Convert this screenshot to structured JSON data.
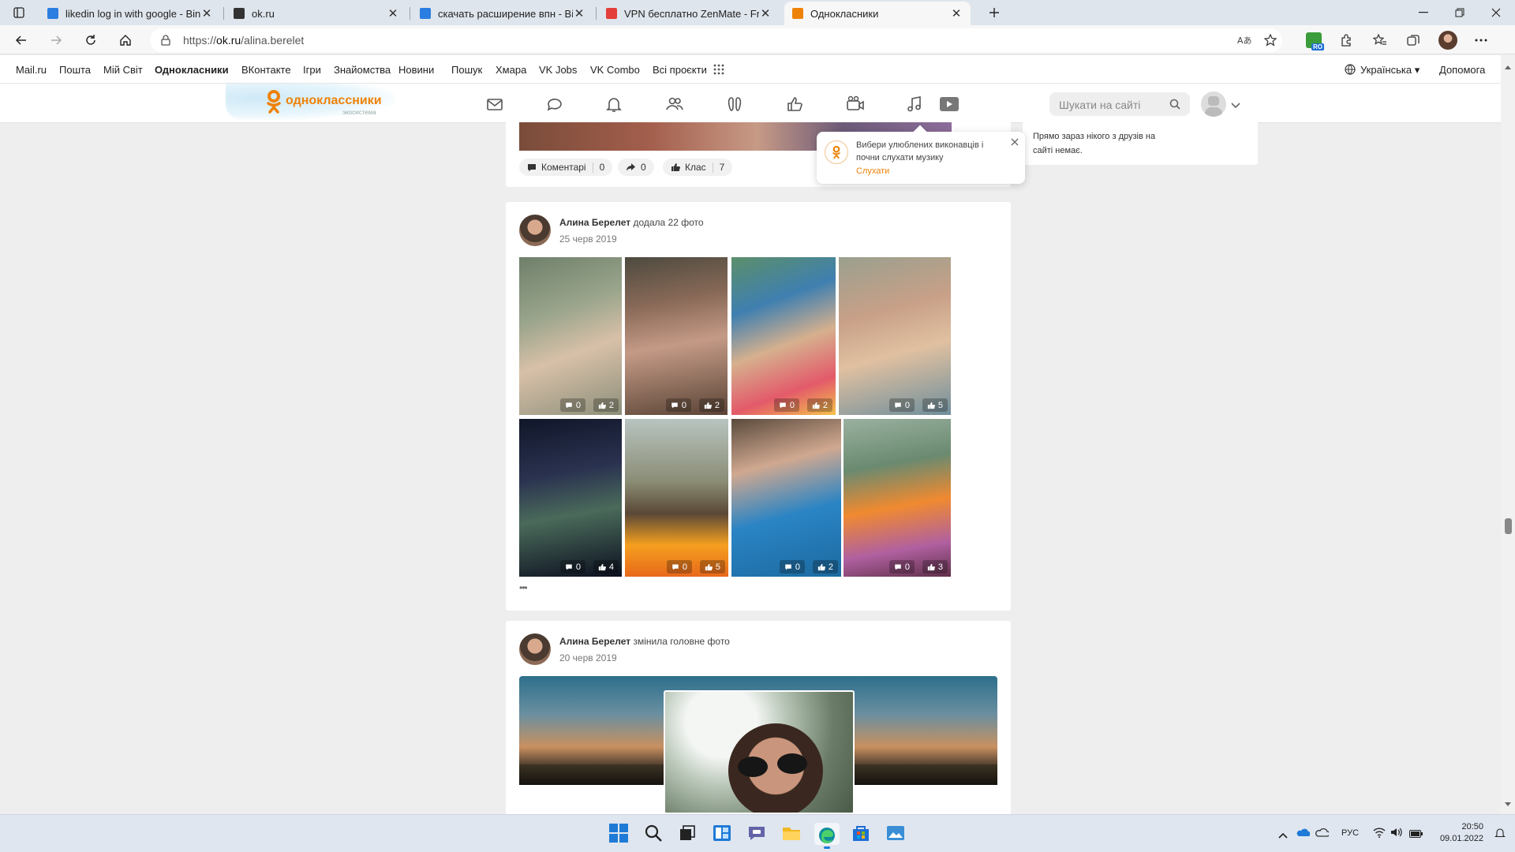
{
  "browser": {
    "tabs": [
      {
        "title": "likedin log in with google - Bing",
        "icon": "bing-icon",
        "color": "#2a7de1",
        "active": false
      },
      {
        "title": "ok.ru",
        "icon": "page-icon",
        "color": "#333333",
        "active": false
      },
      {
        "title": "скачать расширение впн - Bing",
        "icon": "bing-icon",
        "color": "#2a7de1",
        "active": false
      },
      {
        "title": "VPN бесплатно ZenMate - Free",
        "icon": "zenmate-icon",
        "color": "#e43f3a",
        "active": false
      },
      {
        "title": "Однокласники",
        "icon": "ok-icon",
        "color": "#ee8208",
        "active": true
      }
    ],
    "url_prefix": "https://",
    "url_host": "ok.ru",
    "url_path": "/alina.berelet",
    "profile_badge": "RO"
  },
  "portal": {
    "links": [
      "Mail.ru",
      "Пошта",
      "Мій Світ",
      "Однокласники",
      "ВКонтакте",
      "Ігри",
      "Знайомства",
      "Новини",
      "Пошук",
      "Хмара",
      "VK Jobs",
      "VK Combo",
      "Всі проєкти"
    ],
    "language": "Українська",
    "help": "Допомога"
  },
  "ok": {
    "logo_text": "одноклассники",
    "logo_sub": "экосистема",
    "search_placeholder": "Шукати на сайті"
  },
  "post0": {
    "comments_label": "Коментарі",
    "comments_count": "0",
    "shares_count": "0",
    "likes_label": "Клас",
    "likes_count": "7"
  },
  "popup": {
    "text": "Вибери улюблених виконавців і почни слухати музику",
    "action": "Слухати"
  },
  "friends_online": "Прямо зараз нікого з друзів на сайті немає.",
  "post1": {
    "author": "Алина Берелет",
    "action": "додала 22 фото",
    "date": "25 черв 2019",
    "more": "•••",
    "photos": [
      {
        "c": "0",
        "l": "2"
      },
      {
        "c": "0",
        "l": "2"
      },
      {
        "c": "0",
        "l": "2"
      },
      {
        "c": "0",
        "l": "5"
      },
      {
        "c": "0",
        "l": "4"
      },
      {
        "c": "0",
        "l": "5"
      },
      {
        "c": "0",
        "l": "2"
      },
      {
        "c": "0",
        "l": "3"
      }
    ]
  },
  "post2": {
    "author": "Алина Берелет",
    "action": "змінила головне фото",
    "date": "20 черв 2019"
  },
  "taskbar": {
    "lang": "РУС",
    "time": "20:50",
    "date": "09.01.2022"
  }
}
